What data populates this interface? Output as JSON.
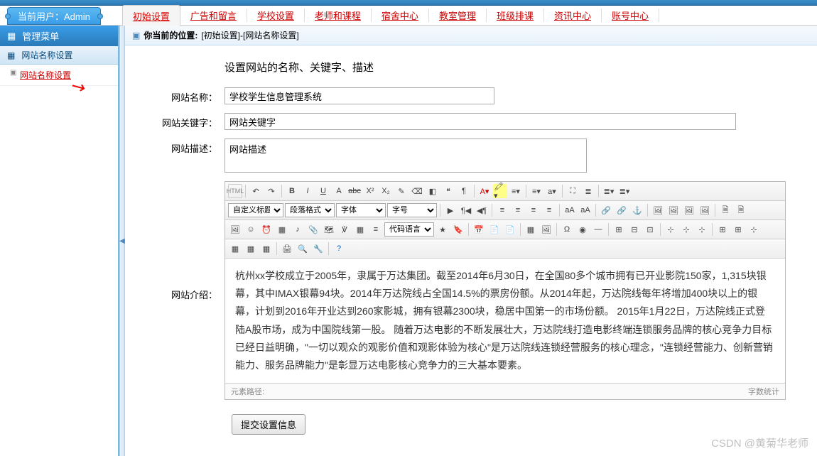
{
  "header": {
    "current_user_label": "当前用户：Admin"
  },
  "nav": {
    "items": [
      {
        "label": "初始设置",
        "active": true
      },
      {
        "label": "广告和留言"
      },
      {
        "label": "学校设置"
      },
      {
        "label": "老师和课程"
      },
      {
        "label": "宿舍中心"
      },
      {
        "label": "教室管理"
      },
      {
        "label": "班级排课"
      },
      {
        "label": "资讯中心"
      },
      {
        "label": "账号中心"
      }
    ]
  },
  "sidebar": {
    "title": "管理菜单",
    "section": "网站名称设置",
    "items": [
      {
        "label": "网站名称设置"
      }
    ]
  },
  "breadcrumb": {
    "label": "你当前的位置:",
    "path": "[初始设置]-[网站名称设置]"
  },
  "form": {
    "title": "设置网站的名称、关键字、描述",
    "name_label": "网站名称：",
    "name_value": "学校学生信息管理系统",
    "keyword_label": "网站关键字：",
    "keyword_value": "网站关键字",
    "desc_label": "网站描述：",
    "desc_value": "网站描述",
    "intro_label": "网站介绍：",
    "submit_label": "提交设置信息"
  },
  "editor": {
    "toolbar": {
      "html_btn": "HTML",
      "select_title": "自定义标题",
      "select_paragraph": "段落格式",
      "select_font": "字体",
      "select_size": "字号",
      "select_lang": "代码语言",
      "icons_row1": [
        "↶",
        "↷",
        "|",
        "B",
        "I",
        "U",
        "A̶",
        "abc",
        "X²",
        "X₂",
        "✎",
        "⌫",
        "◧",
        "❝",
        "¶",
        "|",
        "A▾",
        "🖍▾",
        "≡▾",
        "|",
        "≡▾",
        "≡▾",
        "⊞▾",
        "|",
        "⚙",
        "✕",
        "|",
        "≣▾",
        "≣▾"
      ],
      "icons_row2": [
        "▶",
        "¶◀",
        "◀¶",
        "|",
        "≡",
        "≡",
        "≡",
        "≡",
        "|",
        "аA",
        "аA",
        "|",
        "🔗",
        "🔗",
        "⚓",
        "|",
        "🖼",
        "🖼",
        "🖼",
        "🖼",
        "|",
        "🗎",
        "🗎"
      ],
      "icons_row3": [
        "🖼",
        "☺",
        "⏰",
        "▦",
        "♪",
        "📎",
        "🗺",
        "℣",
        "▦",
        "≡"
      ],
      "icons_row4": [
        "★",
        "🔖",
        "|",
        "📅",
        "📄",
        "📄",
        "|",
        "▦",
        "🖼",
        "|",
        "Ω",
        "◉",
        "—",
        "|",
        "⊞",
        "⊟",
        "⊡",
        "|",
        "⊹",
        "⊹",
        "⊹",
        "|",
        "⊞",
        "⊞",
        "⊹"
      ],
      "icons_row5": [
        "▦",
        "▦",
        "▦",
        "|",
        "🖨",
        "🔍",
        "🔧",
        "|",
        "?"
      ]
    },
    "content": "杭州xx学校成立于2005年，隶属于万达集团。截至2014年6月30日，在全国80多个城市拥有已开业影院150家，1,315块银幕，其中IMAX银幕94块。2014年万达院线占全国14.5%的票房份额。从2014年起，万达院线每年将增加400块以上的银幕，计划到2016年开业达到260家影城，拥有银幕2300块，稳居中国第一的市场份额。  2015年1月22日，万达院线正式登陆A股市场，成为中国院线第一股。  随着万达电影的不断发展壮大，万达院线打造电影终端连锁服务品牌的核心竞争力目标已经日益明确，\"一切以观众的观影价值和观影体验为核心\"是万达院线连锁经营服务的核心理念，\"连锁经营能力、创新营销能力、服务品牌能力\"是彰显万达电影核心竞争力的三大基本要素。",
    "footer_path": "元素路径:",
    "footer_count": "字数统计"
  },
  "watermark": "CSDN @黄菊华老师"
}
